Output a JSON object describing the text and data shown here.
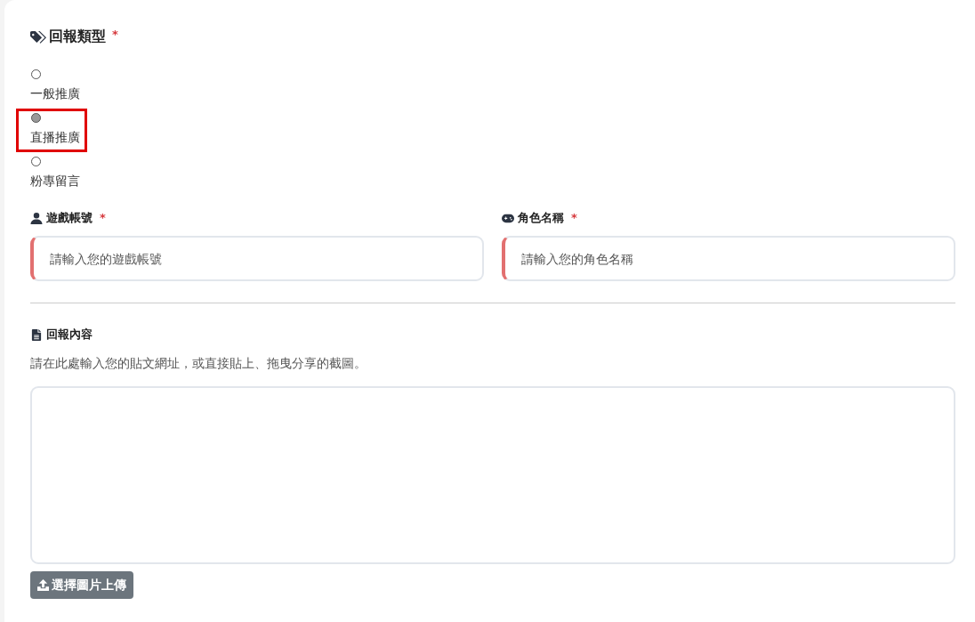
{
  "report_type": {
    "label": "回報類型",
    "required_mark": "*",
    "options": [
      {
        "label": "一般推廣",
        "selected": false,
        "highlighted": false
      },
      {
        "label": "直播推廣",
        "selected": true,
        "highlighted": true
      },
      {
        "label": "粉專留言",
        "selected": false,
        "highlighted": false
      }
    ]
  },
  "fields": [
    {
      "kind": "account",
      "label": "遊戲帳號",
      "required_mark": "*",
      "invalid": true,
      "placeholder": "請輸入您的遊戲帳號"
    },
    {
      "kind": "character",
      "label": "角色名稱",
      "required_mark": "*",
      "invalid": true,
      "placeholder": "請輸入您的角色名稱"
    }
  ],
  "content": {
    "label": "回報內容",
    "hint": "請在此處輸入您的貼文網址，或直接貼上、拖曳分享的截圖。",
    "upload_button": "選擇圖片上傳"
  }
}
